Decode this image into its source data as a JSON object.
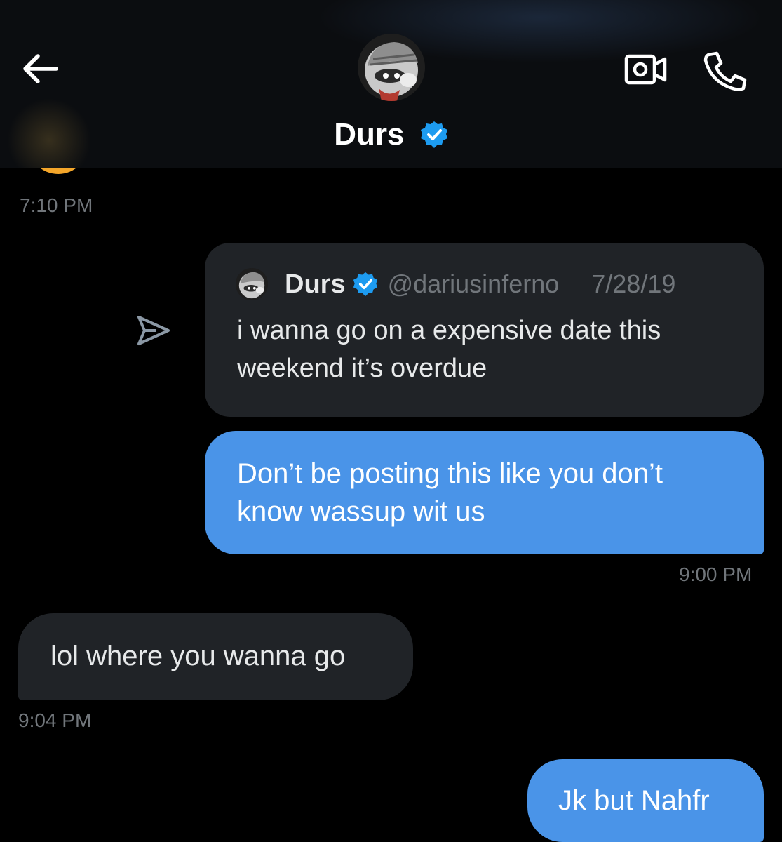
{
  "header": {
    "contact_name": "Durs",
    "verified": true,
    "back_icon": "arrow-left-icon",
    "video_icon": "video-call-icon",
    "phone_icon": "phone-call-icon"
  },
  "messages": {
    "previous_timestamp": "7:10 PM",
    "quoted_post": {
      "name": "Durs",
      "handle": "@dariusinferno",
      "date": "7/28/19",
      "text": "i wanna go on a expensive date this weekend it’s overdue",
      "share_icon": "share-arrow-icon"
    },
    "sent_1": {
      "text": "Don’t be posting this like you don’t know wassup wit us",
      "timestamp": "9:00 PM"
    },
    "received_1": {
      "text": "lol where you wanna go",
      "timestamp": "9:04 PM"
    },
    "sent_2": {
      "text": "Jk but Nahfr"
    }
  },
  "colors": {
    "background": "#000000",
    "header_background": "#0b0d10",
    "sent_bubble": "#4a94e8",
    "received_bubble": "#202327",
    "verified_badge": "#1d9bf0",
    "muted_text": "#71767b"
  }
}
